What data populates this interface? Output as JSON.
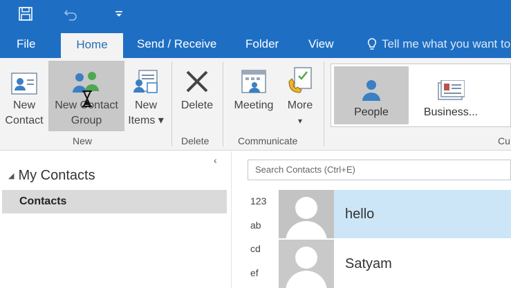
{
  "tabs": {
    "file": "File",
    "home": "Home",
    "send_receive": "Send / Receive",
    "folder": "Folder",
    "view": "View",
    "tell_me": "Tell me what you want to"
  },
  "ribbon": {
    "new_contact": {
      "line1": "New",
      "line2": "Contact"
    },
    "new_contact_group": {
      "line1": "New Contact",
      "line2": "Group"
    },
    "new_items": {
      "line1": "New",
      "line2": "Items ▾"
    },
    "delete": "Delete",
    "meeting": "Meeting",
    "more": {
      "line1": "More",
      "line2": "▾"
    },
    "groups": {
      "new": "New",
      "delete": "Delete",
      "communicate": "Communicate",
      "current_view": "Cu"
    },
    "gallery": {
      "people": "People",
      "business": "Business..."
    }
  },
  "nav": {
    "my_contacts": "My Contacts",
    "contacts": "Contacts"
  },
  "search": {
    "placeholder": "Search Contacts (Ctrl+E)"
  },
  "index": [
    "123",
    "ab",
    "cd",
    "ef"
  ],
  "contacts": [
    {
      "name": "hello"
    },
    {
      "name": "Satyam"
    }
  ],
  "colors": {
    "accent": "#1e6fc4",
    "selected_row": "#cde6f7",
    "ribbon_bg": "#f3f3f3"
  }
}
